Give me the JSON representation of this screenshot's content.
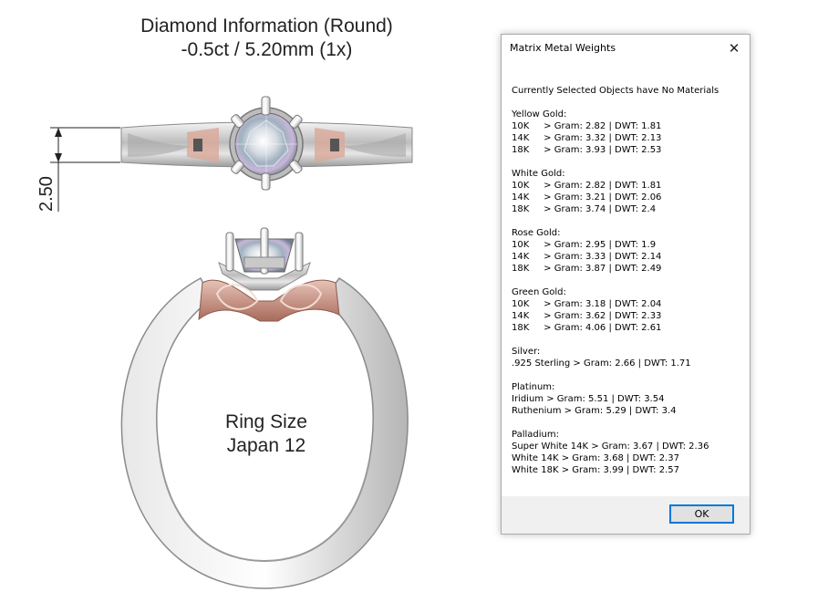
{
  "render": {
    "diamond_title_line1": "Diamond Information (Round)",
    "diamond_title_line2": "-0.5ct / 5.20mm (1x)",
    "dimension_label": "2.50",
    "ring_size_line1": "Ring Size",
    "ring_size_line2": "Japan 12"
  },
  "dialog": {
    "title": "Matrix Metal Weights",
    "close_icon": "close-icon",
    "status": "Currently Selected Objects have No Materials",
    "sections": [
      {
        "heading": "Yellow Gold:",
        "rows": [
          "10K     > Gram: 2.82 | DWT: 1.81",
          "14K     > Gram: 3.32 | DWT: 2.13",
          "18K     > Gram: 3.93 | DWT: 2.53"
        ]
      },
      {
        "heading": "White Gold:",
        "rows": [
          "10K     > Gram: 2.82 | DWT: 1.81",
          "14K     > Gram: 3.21 | DWT: 2.06",
          "18K     > Gram: 3.74 | DWT: 2.4"
        ]
      },
      {
        "heading": "Rose Gold:",
        "rows": [
          "10K     > Gram: 2.95 | DWT: 1.9",
          "14K     > Gram: 3.33 | DWT: 2.14",
          "18K     > Gram: 3.87 | DWT: 2.49"
        ]
      },
      {
        "heading": "Green Gold:",
        "rows": [
          "10K     > Gram: 3.18 | DWT: 2.04",
          "14K     > Gram: 3.62 | DWT: 2.33",
          "18K     > Gram: 4.06 | DWT: 2.61"
        ]
      },
      {
        "heading": "Silver:",
        "rows": [
          ".925 Sterling > Gram: 2.66 | DWT: 1.71"
        ]
      },
      {
        "heading": "Platinum:",
        "rows": [
          "Iridium > Gram: 5.51 | DWT: 3.54",
          "Ruthenium > Gram: 5.29 | DWT: 3.4"
        ]
      },
      {
        "heading": "Palladium:",
        "rows": [
          "Super White 14K > Gram: 3.67 | DWT: 2.36",
          "White 14K > Gram: 3.68 | DWT: 2.37",
          "White 18K > Gram: 3.99 | DWT: 2.57"
        ]
      }
    ],
    "ok_label": "OK"
  },
  "colors": {
    "silver_metal": "#cfcfcf",
    "rose_metal": "#c88e7f",
    "ok_border": "#0078d7",
    "footer_bg": "#f0f0f0"
  }
}
